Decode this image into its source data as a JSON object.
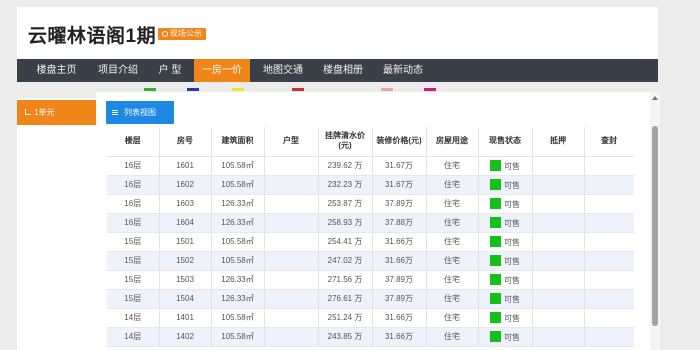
{
  "header": {
    "title": "云曜林语阁1期",
    "badge": "现场公示"
  },
  "nav": {
    "items": [
      {
        "label": "楼盘主页"
      },
      {
        "label": "项目介绍"
      },
      {
        "label": "户 型"
      },
      {
        "label": "一房一价"
      },
      {
        "label": "地图交通"
      },
      {
        "label": "楼盘相册"
      },
      {
        "label": "最新动态"
      }
    ],
    "active_index": 3
  },
  "swatch_colors": [
    "#2eb135",
    "#2b3a9e",
    "#f0e632",
    "#d42a2a",
    "#f2a0a0",
    "#d6197a"
  ],
  "sidebar": {
    "unit_label": "1单元"
  },
  "view": {
    "tab_label": "列表视图"
  },
  "table": {
    "headers": [
      "楼层",
      "房号",
      "建筑面积",
      "户型",
      "挂牌清水价(元)",
      "装修价格(元)",
      "房屋用途",
      "现售状态",
      "抵押",
      "查封"
    ],
    "rows": [
      [
        "16层",
        "1601",
        "105.58㎡",
        "",
        "239.62 万",
        "31.67万",
        "住宅",
        "可售",
        "",
        ""
      ],
      [
        "16层",
        "1602",
        "105.58㎡",
        "",
        "232.23 万",
        "31.67万",
        "住宅",
        "可售",
        "",
        ""
      ],
      [
        "16层",
        "1603",
        "126.33㎡",
        "",
        "253.87 万",
        "37.89万",
        "住宅",
        "可售",
        "",
        ""
      ],
      [
        "16层",
        "1604",
        "126.33㎡",
        "",
        "258.93 万",
        "37.88万",
        "住宅",
        "可售",
        "",
        ""
      ],
      [
        "15层",
        "1501",
        "105.58㎡",
        "",
        "254.41 万",
        "31.66万",
        "住宅",
        "可售",
        "",
        ""
      ],
      [
        "15层",
        "1502",
        "105.58㎡",
        "",
        "247.02 万",
        "31.66万",
        "住宅",
        "可售",
        "",
        ""
      ],
      [
        "15层",
        "1503",
        "126.33㎡",
        "",
        "271.56 万",
        "37.89万",
        "住宅",
        "可售",
        "",
        ""
      ],
      [
        "15层",
        "1504",
        "126.33㎡",
        "",
        "276.61 万",
        "37.89万",
        "住宅",
        "可售",
        "",
        ""
      ],
      [
        "14层",
        "1401",
        "105.58㎡",
        "",
        "251.24 万",
        "31.66万",
        "住宅",
        "可售",
        "",
        ""
      ],
      [
        "14层",
        "1402",
        "105.58㎡",
        "",
        "243.85 万",
        "31.66万",
        "住宅",
        "可售",
        "",
        ""
      ]
    ],
    "status_color": "#15c018"
  },
  "colors": {
    "accent": "#f08519",
    "nav_bg": "#394047",
    "view_tab": "#1e88e5"
  }
}
